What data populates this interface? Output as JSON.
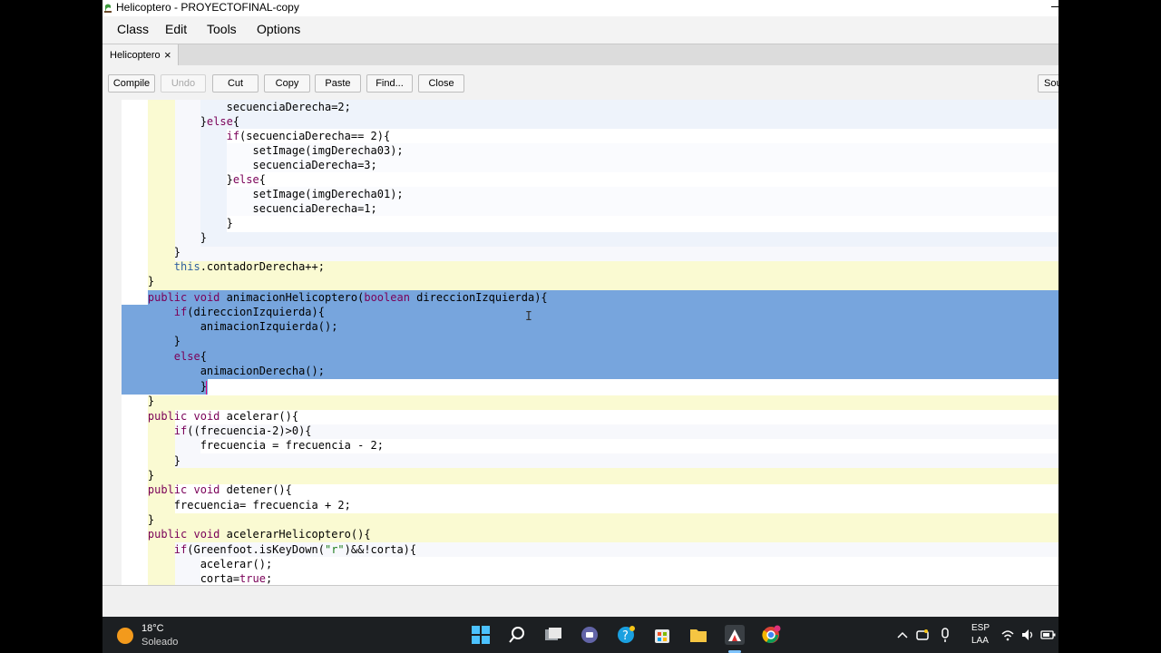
{
  "window": {
    "title": "Helicoptero - PROYECTOFINAL-copy"
  },
  "menu": [
    "Class",
    "Edit",
    "Tools",
    "Options"
  ],
  "tab": {
    "label": "Helicoptero",
    "close": "×"
  },
  "toolbar": {
    "compile": "Compile",
    "undo": "Undo",
    "cut": "Cut",
    "copy": "Copy",
    "paste": "Paste",
    "find": "Find...",
    "close": "Close",
    "source": "Sou"
  },
  "code": [
    "                secuenciaDerecha=2;",
    "            }else{",
    "                if(secuenciaDerecha== 2){",
    "                    setImage(imgDerecha03);",
    "                    secuenciaDerecha=3;",
    "                }else{",
    "                    setImage(imgDerecha01);",
    "                    secuenciaDerecha=1;",
    "                }",
    "            }",
    "        }",
    "        this.contadorDerecha++;",
    "    }",
    "    public void animacionHelicoptero(boolean direccionIzquierda){",
    "        if(direccionIzquierda){",
    "            animacionIzquierda();",
    "        }",
    "        else{",
    "            animacionDerecha();",
    "            }",
    "    }",
    "    public void acelerar(){",
    "        if((frecuencia-2)>0){",
    "            frecuencia = frecuencia - 2;",
    "        }",
    "    }",
    "    public void detener(){",
    "        frecuencia= frecuencia + 2;",
    "    }",
    "    public void acelerarHelicoptero(){",
    "        if(Greenfoot.isKeyDown(\"r\")&&!corta){",
    "            acelerar();",
    "            corta=true;"
  ],
  "taskbar": {
    "weather_temp": "18°C",
    "weather_desc": "Soleado",
    "lang_1": "ESP",
    "lang_2": "LAA"
  }
}
